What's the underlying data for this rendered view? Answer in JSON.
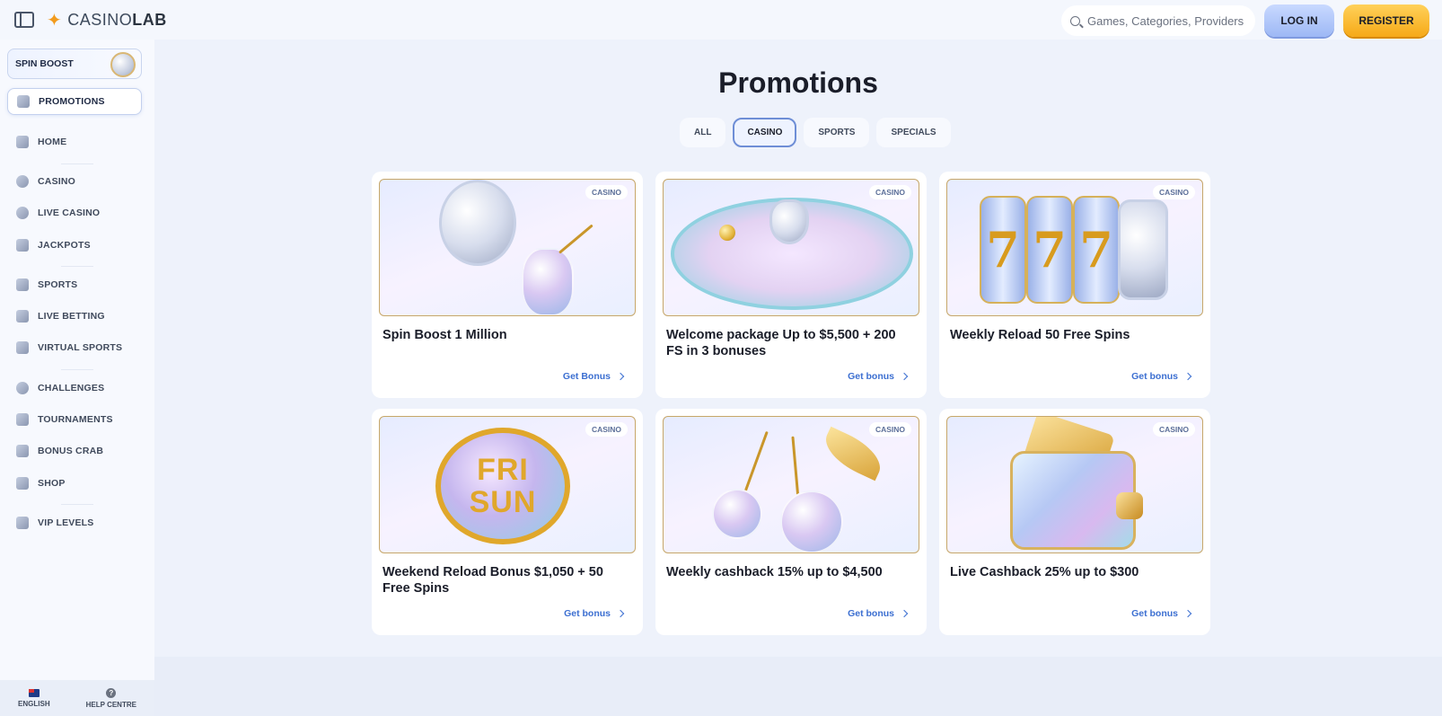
{
  "header": {
    "logo_left": "CASINO",
    "logo_right": "LAB",
    "search_placeholder": "Games, Categories, Providers",
    "login_label": "LOG IN",
    "register_label": "REGISTER"
  },
  "sidebar": {
    "spin_boost_label": "SPIN BOOST",
    "items": [
      {
        "label": "PROMOTIONS",
        "icon": "promotions-icon",
        "active": true
      },
      {
        "label": "HOME",
        "icon": "home-icon"
      },
      {
        "label": "CASINO",
        "icon": "casino-chip-icon"
      },
      {
        "label": "LIVE CASINO",
        "icon": "live-casino-icon"
      },
      {
        "label": "JACKPOTS",
        "icon": "jackpot-icon"
      },
      {
        "label": "SPORTS",
        "icon": "sports-icon"
      },
      {
        "label": "LIVE BETTING",
        "icon": "live-betting-icon"
      },
      {
        "label": "VIRTUAL SPORTS",
        "icon": "virtual-sports-icon"
      },
      {
        "label": "CHALLENGES",
        "icon": "challenges-icon"
      },
      {
        "label": "TOURNAMENTS",
        "icon": "trophy-icon"
      },
      {
        "label": "BONUS CRAB",
        "icon": "bonus-crab-icon"
      },
      {
        "label": "SHOP",
        "icon": "shop-icon"
      },
      {
        "label": "VIP LEVELS",
        "icon": "crown-icon"
      }
    ],
    "footer": {
      "language": "ENGLISH",
      "help": "HELP CENTRE"
    }
  },
  "main": {
    "title": "Promotions",
    "filters": [
      {
        "label": "ALL",
        "active": false
      },
      {
        "label": "CASINO",
        "active": true
      },
      {
        "label": "SPORTS",
        "active": false
      },
      {
        "label": "SPECIALS",
        "active": false
      }
    ],
    "cards": [
      {
        "badge": "CASINO",
        "title": "Spin Boost 1 Million",
        "cta": "Get Bonus"
      },
      {
        "badge": "CASINO",
        "title": "Welcome package Up to $5,500 + 200 FS in 3 bonuses",
        "cta": "Get bonus"
      },
      {
        "badge": "CASINO",
        "title": "Weekly Reload 50 Free Spins",
        "cta": "Get bonus"
      },
      {
        "badge": "CASINO",
        "title": "Weekend Reload Bonus $1,050 + 50 Free Spins",
        "cta": "Get bonus"
      },
      {
        "badge": "CASINO",
        "title": "Weekly cashback 15% up to $4,500",
        "cta": "Get bonus"
      },
      {
        "badge": "CASINO",
        "title": "Live Cashback 25% up to $300",
        "cta": "Get bonus"
      }
    ],
    "art_text": {
      "reel_digit": "7",
      "fri": "FRI",
      "sun": "SUN"
    }
  },
  "colors": {
    "accent": "#3c6fd1",
    "register": "#f6a917",
    "login": "#9db8f5",
    "background": "#eef2fb"
  }
}
